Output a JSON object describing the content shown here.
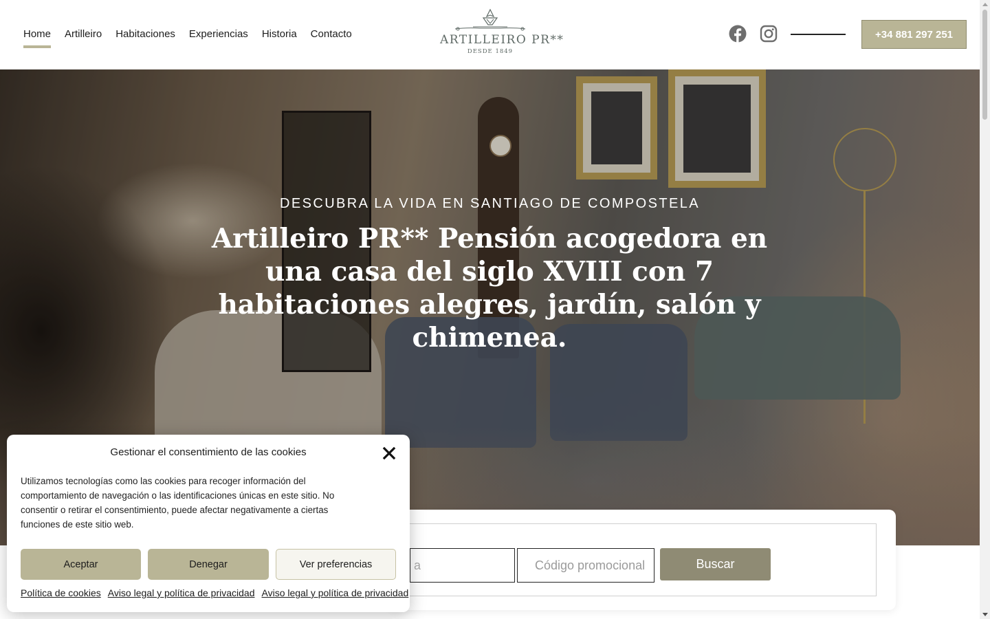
{
  "nav": {
    "items": [
      {
        "label": "Home",
        "active": true
      },
      {
        "label": "Artilleiro"
      },
      {
        "label": "Habitaciones"
      },
      {
        "label": "Experiencias"
      },
      {
        "label": "Historia"
      },
      {
        "label": "Contacto"
      }
    ]
  },
  "logo": {
    "name": "ARTILLEIRO PR**",
    "tagline": "DESDE 1849"
  },
  "header": {
    "social_icons": [
      "facebook-icon",
      "instagram-icon"
    ],
    "phone": "+34 881 297 251"
  },
  "hero": {
    "eyebrow": "DESCUBRA LA VIDA EN SANTIAGO DE COMPOSTELA",
    "title": "Artilleiro PR** Pensión acogedora en una casa del siglo XVIII con 7 habitaciones alegres, jardín, salón y chimenea."
  },
  "booking": {
    "partial_field_text": "a",
    "promo_placeholder": "Código promocional",
    "search_label": "Buscar"
  },
  "cookie": {
    "title": "Gestionar el consentimiento de las cookies",
    "text": "Utilizamos tecnologías como las cookies para recoger información del comportamiento de navegación o las identificaciones únicas en este sitio. No consentir o retirar el consentimiento, puede afectar negativamente a ciertas funciones de este sitio web.",
    "accept_label": "Aceptar",
    "deny_label": "Denegar",
    "prefs_label": "Ver preferencias",
    "links": [
      "Política de cookies",
      "Aviso legal y política de privacidad",
      "Aviso legal y política de privacidad"
    ]
  },
  "colors": {
    "accent": "#b9b596",
    "button_dark": "#8f8b74",
    "logo": "#5f6a66"
  }
}
